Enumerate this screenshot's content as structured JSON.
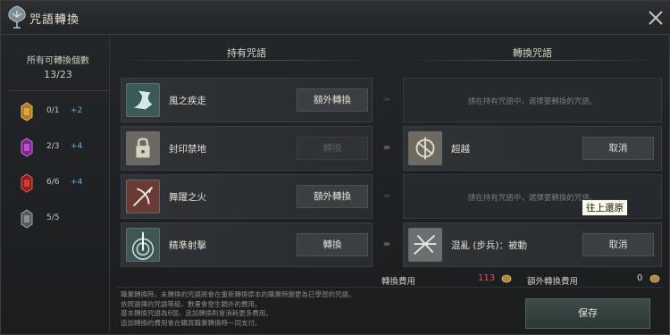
{
  "window": {
    "title": "咒語轉換"
  },
  "left_panel": {
    "count_label": "所有可轉換個數",
    "count_value": "13/23",
    "categories": [
      {
        "icon": "golden-totem-icon",
        "count": "0/1",
        "bonus": "+2"
      },
      {
        "icon": "purple-totem-icon",
        "count": "2/3",
        "bonus": "+4"
      },
      {
        "icon": "red-totem-icon",
        "count": "6/6",
        "bonus": "+4"
      },
      {
        "icon": "grey-totem-icon",
        "count": "5/5",
        "bonus": ""
      }
    ]
  },
  "columns": {
    "owned": "持有咒語",
    "convert": "轉換咒語"
  },
  "rows": [
    {
      "name": "風之疾走",
      "button": "額外轉換",
      "button_disabled": false,
      "target": null,
      "hint": "請在持有咒語中，選擇要轉換的咒語。"
    },
    {
      "name": "封印禁地",
      "button": "轉換",
      "button_disabled": true,
      "target": {
        "name": "超越",
        "button": "取消"
      },
      "hint": ""
    },
    {
      "name": "舞躍之火",
      "button": "額外轉換",
      "button_disabled": false,
      "target": null,
      "hint": "請在持有咒語中，選擇要轉換的咒語。"
    },
    {
      "name": "精準射擊",
      "button": "轉換",
      "button_disabled": false,
      "target": {
        "name": "混亂 (步兵)：被動",
        "button": "取消"
      },
      "hint": ""
    }
  ],
  "tooltip": "往上還原",
  "fees": {
    "convert_label": "轉換費用",
    "convert_value": "113",
    "extra_label": "額外轉換費用",
    "extra_value": "0"
  },
  "notes": [
    "職業轉換時，未轉換的咒語將會在重新轉換原本的職業時變更為已學習的咒語。",
    "依照選擇的咒語等級，數量會發生額外的費用。",
    "基本轉換咒語為6個，追加轉換則會消耗更多費用。",
    "追加轉換的費用會在購買職業轉換時一同支付。"
  ],
  "save_label": "保存",
  "colors": {
    "accent_blue": "#6fa8d8",
    "fee_red": "#d9534f"
  }
}
